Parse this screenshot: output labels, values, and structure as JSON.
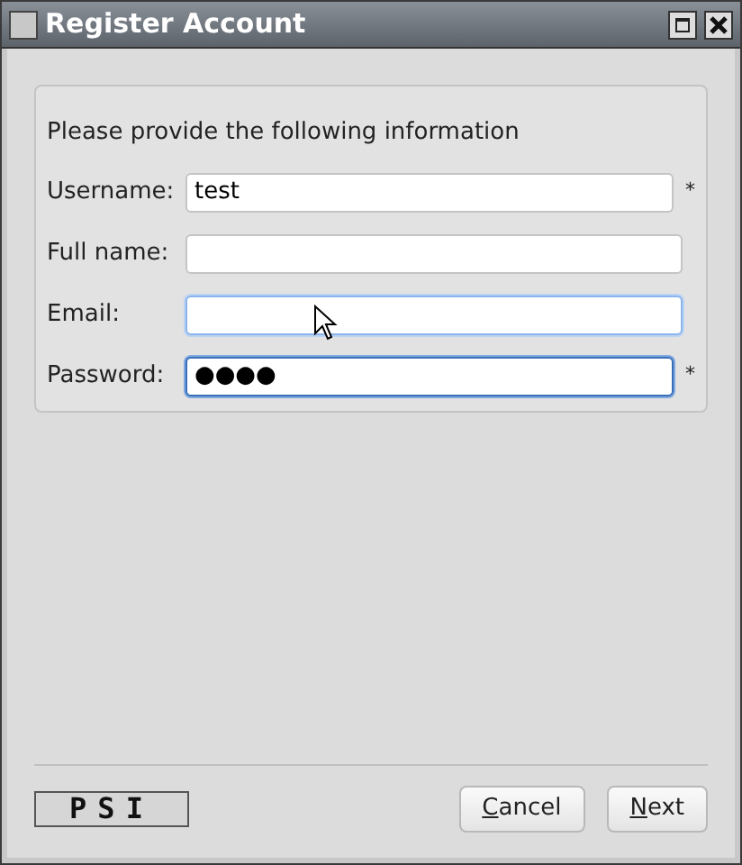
{
  "window": {
    "title": "Register Account"
  },
  "intro": "Please provide the following information",
  "fields": [
    {
      "label": "Username:",
      "value": "test",
      "required": true,
      "focused": false,
      "hovered": false
    },
    {
      "label": "Full name:",
      "required": false,
      "focused": false,
      "hovered": false
    },
    {
      "label": "Email:",
      "required": false,
      "focused": false,
      "hovered": true
    },
    {
      "label": "Password:",
      "value": "●●●●",
      "required": true,
      "focused": true,
      "hovered": false
    }
  ],
  "required_mark": "*",
  "logo": "PSI",
  "buttons": [
    {
      "label": "Cancel",
      "mnemonic": true
    },
    {
      "label": "Next",
      "mnemonic": true
    }
  ]
}
